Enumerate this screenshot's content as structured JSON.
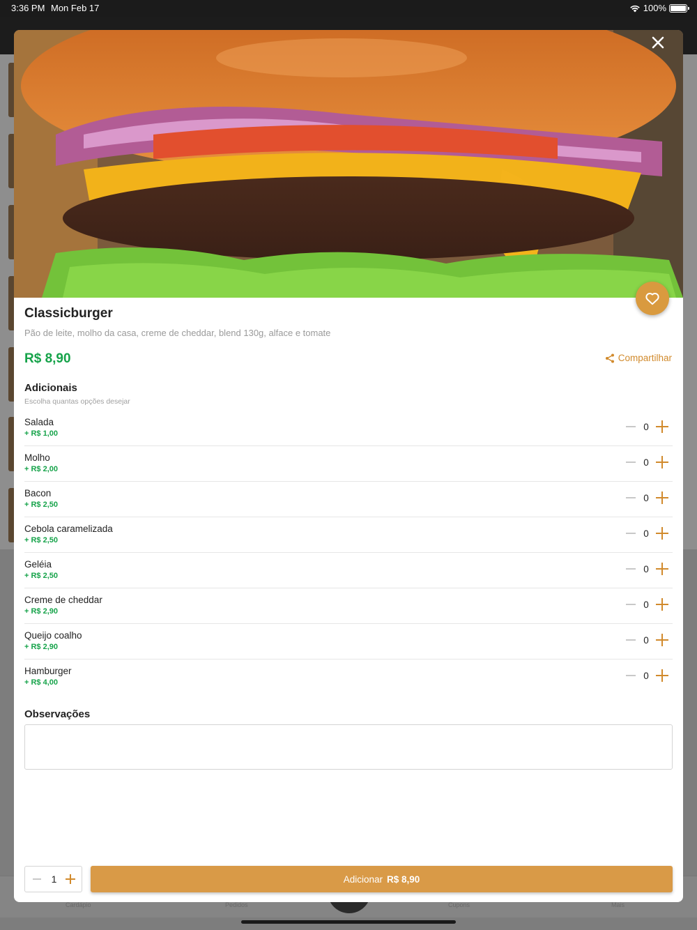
{
  "status_bar": {
    "time": "3:36 PM",
    "date": "Mon Feb 17",
    "battery": "100%"
  },
  "background_tabs": [
    "Cardápio",
    "Pedidos",
    "Cupons",
    "Mais"
  ],
  "product": {
    "name": "Classicburger",
    "description": "Pão de leite, molho da casa, creme de cheddar, blend 130g, alface e tomate",
    "price": "R$ 8,90",
    "share_label": "Compartilhar"
  },
  "addons_section": {
    "title": "Adicionais",
    "subtitle": "Escolha quantas opções desejar",
    "items": [
      {
        "name": "Salada",
        "price": "+ R$ 1,00",
        "qty": "0"
      },
      {
        "name": "Molho",
        "price": "+ R$ 2,00",
        "qty": "0"
      },
      {
        "name": "Bacon",
        "price": "+ R$ 2,50",
        "qty": "0"
      },
      {
        "name": "Cebola caramelizada",
        "price": "+ R$ 2,50",
        "qty": "0"
      },
      {
        "name": "Geléia",
        "price": "+ R$ 2,50",
        "qty": "0"
      },
      {
        "name": "Creme de cheddar",
        "price": "+ R$ 2,90",
        "qty": "0"
      },
      {
        "name": "Queijo coalho",
        "price": "+ R$ 2,90",
        "qty": "0"
      },
      {
        "name": "Hamburger",
        "price": "+ R$ 4,00",
        "qty": "0"
      }
    ]
  },
  "observations": {
    "title": "Observações",
    "value": ""
  },
  "footer": {
    "quantity": "1",
    "add_label": "Adicionar",
    "add_amount": "R$ 8,90"
  },
  "colors": {
    "accent": "#d99a47",
    "price_green": "#16a34a",
    "share_orange": "#d18a2c"
  }
}
